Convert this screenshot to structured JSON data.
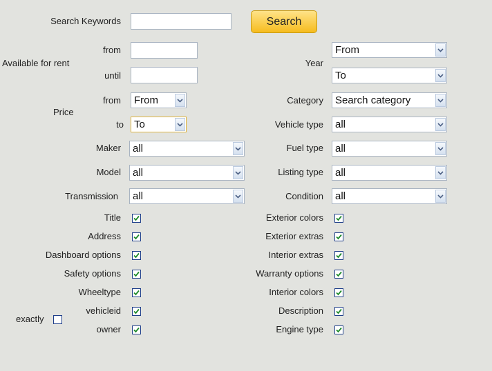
{
  "search": {
    "label": "Search Keywords",
    "value": "",
    "button_label": "Search"
  },
  "rent": {
    "label": "Available for rent",
    "from_label": "from",
    "until_label": "until",
    "from_value": "",
    "until_value": ""
  },
  "year": {
    "label": "Year",
    "from_value": "From",
    "to_value": "To"
  },
  "price": {
    "label": "Price",
    "from_label": "from",
    "to_label": "to",
    "from_value": "From",
    "to_value": "To"
  },
  "category": {
    "label": "Category",
    "value": "Search category"
  },
  "vehicle_type": {
    "label": "Vehicle type",
    "value": "all"
  },
  "maker": {
    "label": "Maker",
    "value": "all"
  },
  "fuel_type": {
    "label": "Fuel type",
    "value": "all"
  },
  "model": {
    "label": "Model",
    "value": "all"
  },
  "listing_type": {
    "label": "Listing type",
    "value": "all"
  },
  "transmission": {
    "label": "Transmission",
    "value": "all"
  },
  "condition": {
    "label": "Condition",
    "value": "all"
  },
  "exactly": {
    "label": "exactly",
    "checked": false
  },
  "fields_left": [
    {
      "label": "Title",
      "checked": true
    },
    {
      "label": "Address",
      "checked": true
    },
    {
      "label": "Dashboard options",
      "checked": true
    },
    {
      "label": "Safety options",
      "checked": true
    },
    {
      "label": "Wheeltype",
      "checked": true
    },
    {
      "label": "vehicleid",
      "checked": true
    },
    {
      "label": "owner",
      "checked": true
    }
  ],
  "fields_right": [
    {
      "label": "Exterior colors",
      "checked": true
    },
    {
      "label": "Exterior extras",
      "checked": true
    },
    {
      "label": "Interior extras",
      "checked": true
    },
    {
      "label": "Warranty options",
      "checked": true
    },
    {
      "label": "Interior colors",
      "checked": true
    },
    {
      "label": "Description",
      "checked": true
    },
    {
      "label": "Engine type",
      "checked": true
    }
  ],
  "icons": {
    "dropdown": "chevron-down-icon",
    "checkbox": "checkmark-icon"
  }
}
